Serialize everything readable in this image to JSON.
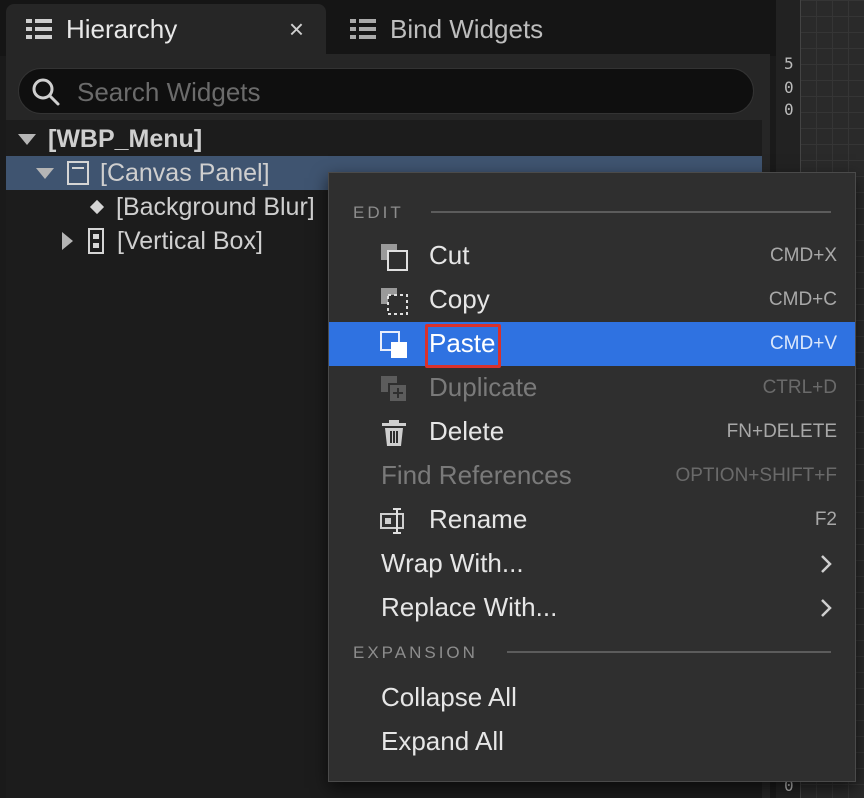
{
  "tabs": [
    {
      "label": "Hierarchy",
      "icon": "list-icon",
      "active": true,
      "close": "×"
    },
    {
      "label": "Bind Widgets",
      "icon": "list-icon",
      "active": false
    }
  ],
  "search": {
    "placeholder": "Search Widgets",
    "value": ""
  },
  "tree": [
    {
      "label": "[WBP_Menu]",
      "expander": "down",
      "icon": null
    },
    {
      "label": "[Canvas Panel]",
      "expander": "down",
      "icon": "canvas-panel-icon",
      "selected": true
    },
    {
      "label": "[Background Blur]",
      "expander": null,
      "icon": "diamond-icon"
    },
    {
      "label": "[Vertical Box]",
      "expander": "right",
      "icon": "vertical-box-icon"
    }
  ],
  "ruler": {
    "digits": [
      "5",
      "0",
      "0"
    ],
    "bottom_digit": "0"
  },
  "context_menu": {
    "sections": {
      "edit": "EDIT",
      "expansion": "EXPANSION"
    },
    "items": [
      {
        "label": "Cut",
        "shortcut": "CMD+X",
        "icon": "cut-icon"
      },
      {
        "label": "Copy",
        "shortcut": "CMD+C",
        "icon": "copy-icon"
      },
      {
        "label": "Paste",
        "shortcut": "CMD+V",
        "icon": "paste-icon",
        "highlighted": true
      },
      {
        "label": "Duplicate",
        "shortcut": "CTRL+D",
        "icon": "duplicate-icon",
        "disabled": true
      },
      {
        "label": "Delete",
        "shortcut": "FN+DELETE",
        "icon": "trash-icon"
      },
      {
        "label": "Find References",
        "shortcut": "OPTION+SHIFT+F",
        "icon": null,
        "disabled": true
      },
      {
        "label": "Rename",
        "shortcut": "F2",
        "icon": "rename-icon"
      },
      {
        "label": "Wrap With...",
        "submenu": true
      },
      {
        "label": "Replace With...",
        "submenu": true
      },
      {
        "label": "Collapse All"
      },
      {
        "label": "Expand All"
      }
    ]
  },
  "colors": {
    "highlight": "#2f72e1",
    "selected_row": "#3f5470",
    "annotation_box": "#d9312b"
  }
}
